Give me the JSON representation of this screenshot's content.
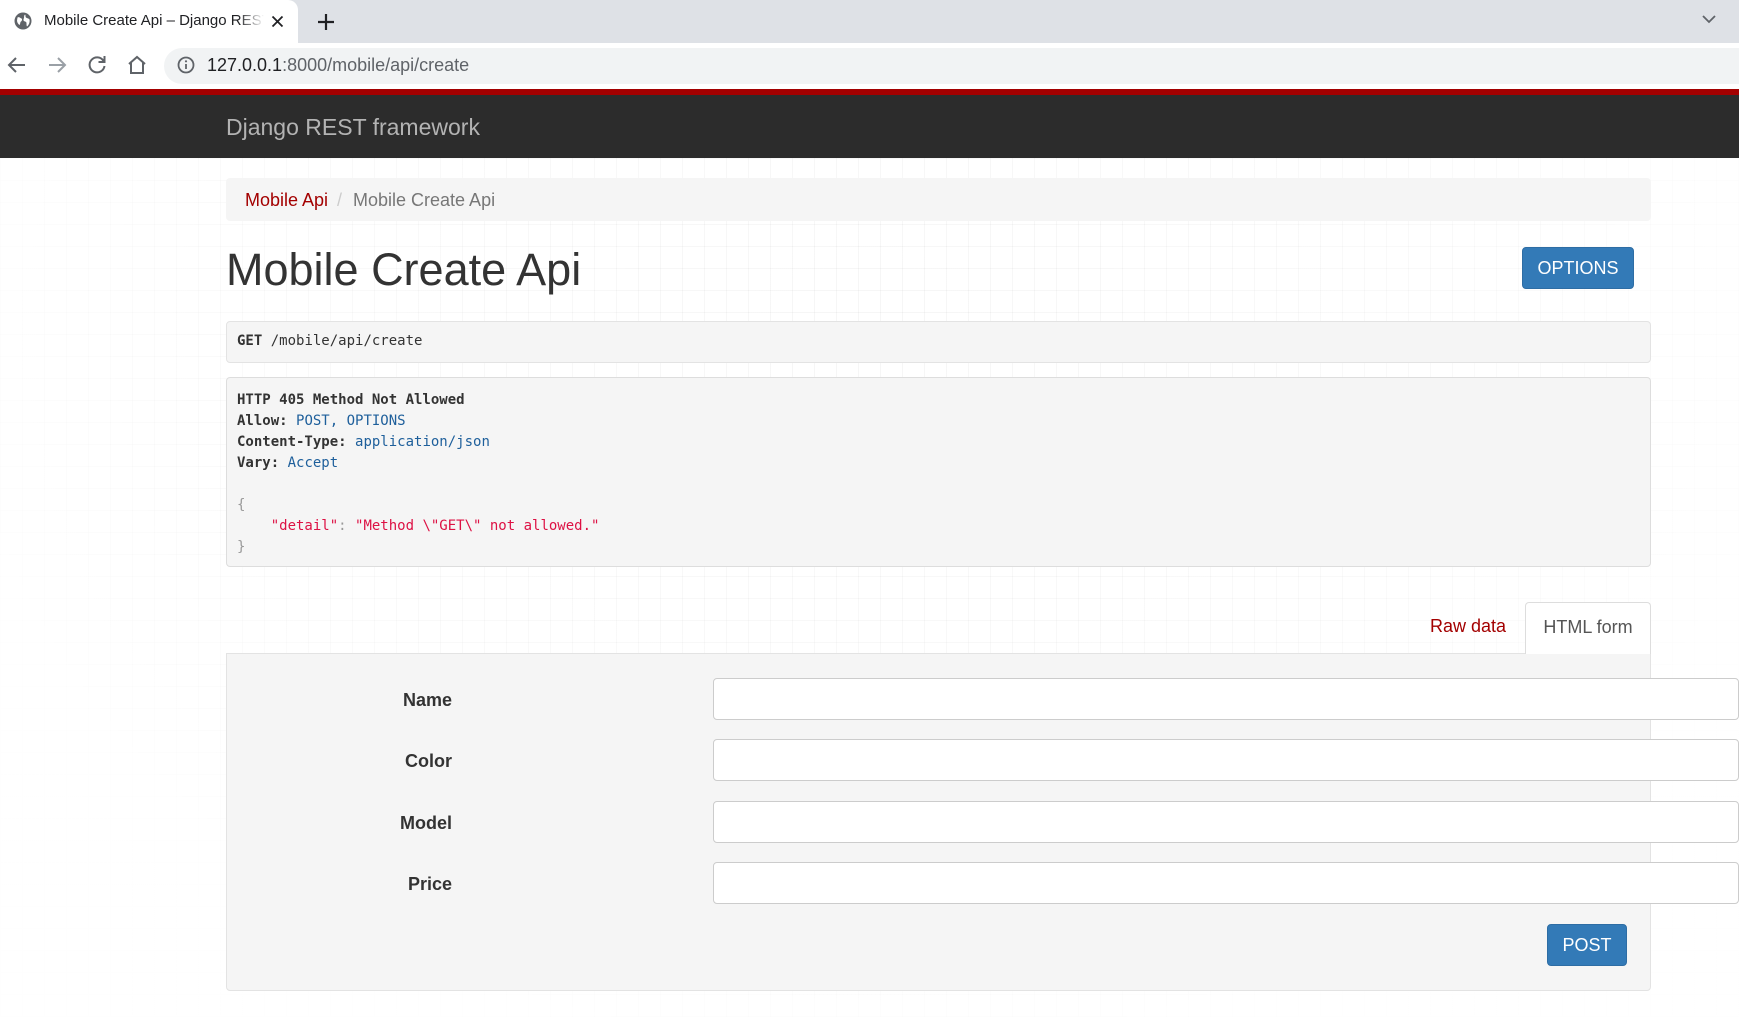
{
  "browser": {
    "tab_title": "Mobile Create Api – Django REST framework",
    "url_host": "127.0.0.1",
    "url_rest": ":8000/mobile/api/create"
  },
  "navbar": {
    "brand": "Django REST framework"
  },
  "breadcrumb": {
    "items": [
      "Mobile Api",
      "Mobile Create Api"
    ],
    "separator": "/"
  },
  "header": {
    "title": "Mobile Create Api",
    "options_label": "OPTIONS"
  },
  "request": {
    "method": "GET",
    "path": "/mobile/api/create"
  },
  "response": {
    "status": "HTTP 405 Method Not Allowed",
    "headers": [
      {
        "key": "Allow:",
        "value": "POST, OPTIONS"
      },
      {
        "key": "Content-Type:",
        "value": "application/json"
      },
      {
        "key": "Vary:",
        "value": "Accept"
      }
    ],
    "body_open": "{",
    "body_key": "\"detail\"",
    "body_colon": ": ",
    "body_value": "\"Method \\\"GET\\\" not allowed.\"",
    "body_close": "}"
  },
  "forms": {
    "tabs": [
      "Raw data",
      "HTML form"
    ],
    "active_tab": "HTML form",
    "fields": [
      {
        "label": "Name",
        "value": ""
      },
      {
        "label": "Color",
        "value": ""
      },
      {
        "label": "Model",
        "value": ""
      },
      {
        "label": "Price",
        "value": ""
      }
    ],
    "submit_label": "POST"
  },
  "colors": {
    "accent_red": "#a30000",
    "navbar_bg": "#2c2c2c",
    "button_blue": "#337ab7"
  },
  "icons": [
    "globe-icon",
    "close-icon",
    "plus-icon",
    "chevron-down-icon",
    "back-arrow-icon",
    "forward-arrow-icon",
    "reload-icon",
    "home-icon",
    "info-icon"
  ]
}
